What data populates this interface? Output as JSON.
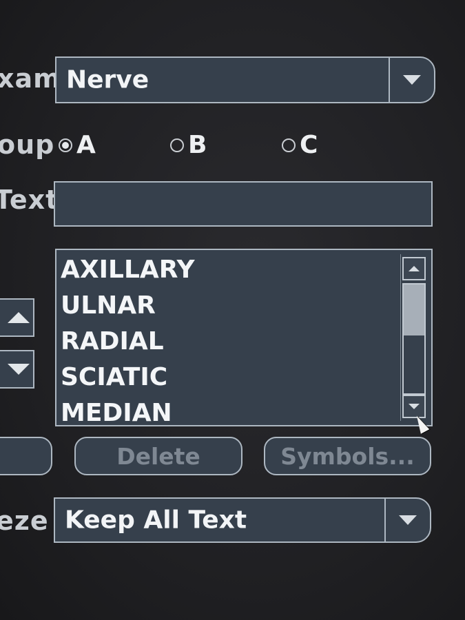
{
  "exam": {
    "label": "xam",
    "selected": "Nerve"
  },
  "group": {
    "label": "oup",
    "options": [
      {
        "label": "A",
        "selected": true
      },
      {
        "label": "B",
        "selected": false
      },
      {
        "label": "C",
        "selected": false
      }
    ]
  },
  "text_field": {
    "label": "Text",
    "value": ""
  },
  "annotation_list": {
    "items": [
      "AXILLARY",
      "ULNAR",
      "RADIAL",
      "SCIATIC",
      "MEDIAN"
    ]
  },
  "buttons": {
    "delete_label": "Delete",
    "symbols_label": "Symbols..."
  },
  "freeze": {
    "label": "eze",
    "selected": "Keep All Text"
  },
  "colors": {
    "panel": "#36404c",
    "border": "#aeb8c2",
    "disabled_text": "#7f8893"
  }
}
